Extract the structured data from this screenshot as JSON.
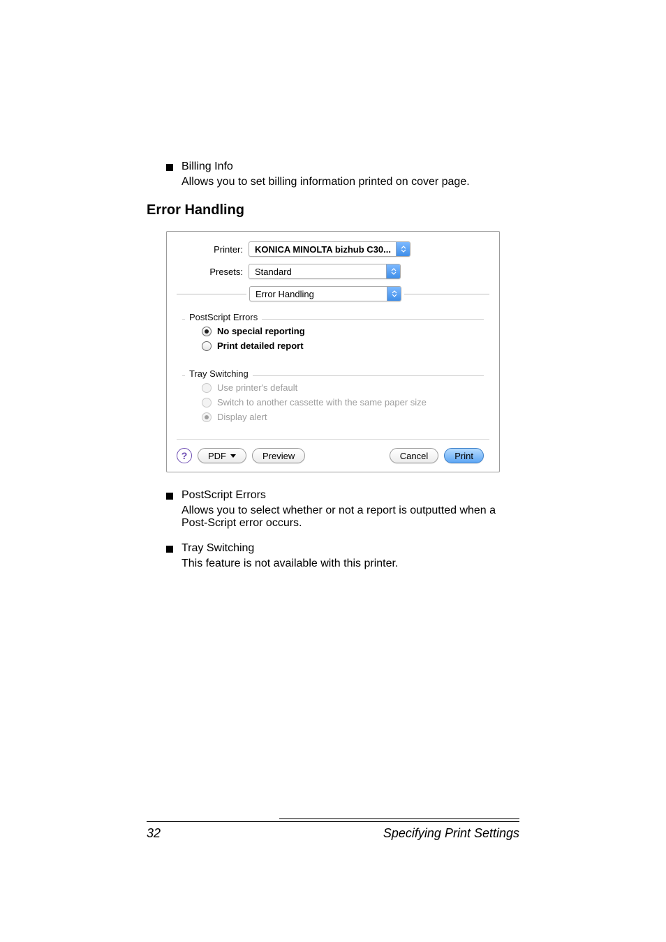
{
  "bullets": {
    "billing": {
      "title": "Billing Info",
      "desc": "Allows you to set billing information printed on cover page."
    },
    "postscript": {
      "title": "PostScript Errors",
      "desc": "Allows you to select whether or not a report is outputted when a Post-Script error occurs."
    },
    "tray": {
      "title": "Tray Switching",
      "desc": "This feature is not available with this printer."
    }
  },
  "heading": "Error Handling",
  "dialog": {
    "printer_label": "Printer:",
    "printer_value": "KONICA MINOLTA bizhub C30...",
    "presets_label": "Presets:",
    "presets_value": "Standard",
    "pane_value": "Error Handling",
    "group_ps": {
      "title": "PostScript Errors",
      "opt1": "No special reporting",
      "opt2": "Print detailed report"
    },
    "group_tray": {
      "title": "Tray Switching",
      "opt1": "Use printer's default",
      "opt2": "Switch to another cassette with the same paper size",
      "opt3": "Display alert"
    },
    "buttons": {
      "pdf": "PDF",
      "preview": "Preview",
      "cancel": "Cancel",
      "print": "Print"
    }
  },
  "footer": {
    "page": "32",
    "title": "Specifying Print Settings"
  }
}
